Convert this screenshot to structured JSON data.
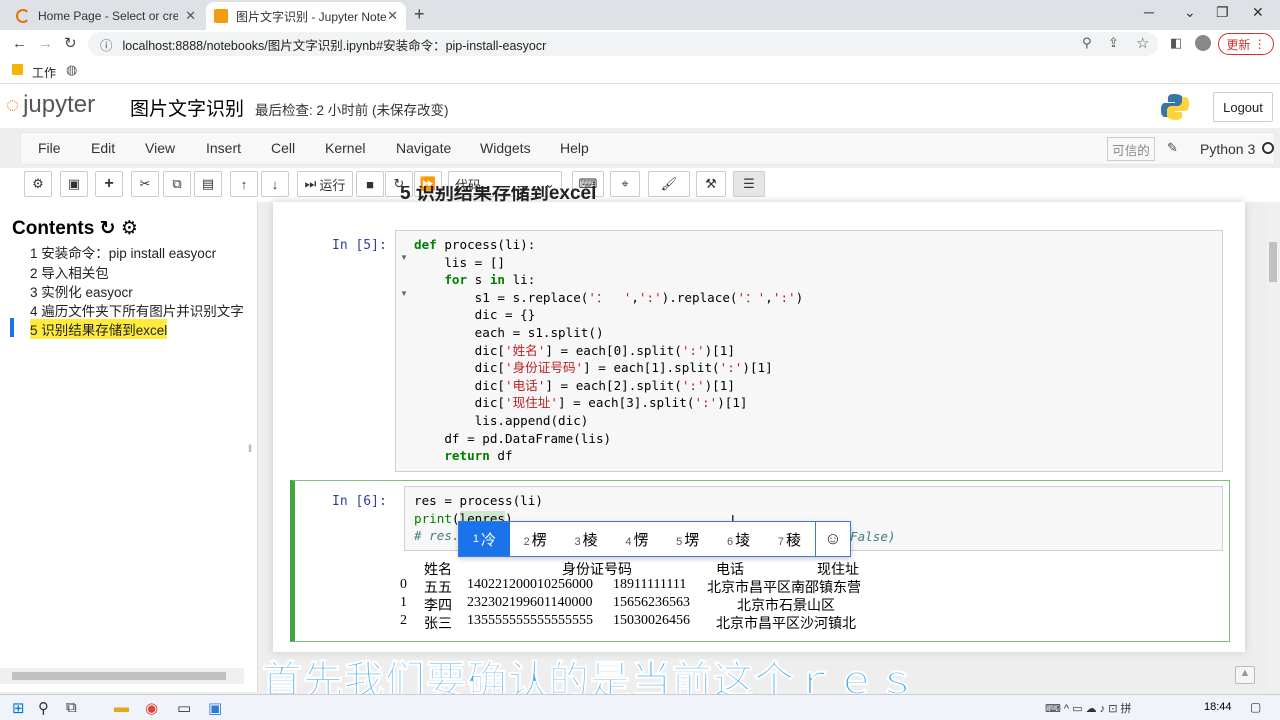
{
  "browser": {
    "tabs": [
      {
        "title": "Home Page - Select or create a",
        "active": false
      },
      {
        "title": "图片文字识别 - Jupyter Notebo",
        "active": true
      }
    ],
    "url": "localhost:8888/notebooks/图片文字识别.ipynb#安装命令：pip-install-easyocr",
    "bookmark": "工作",
    "update_label": "更新"
  },
  "jupyter": {
    "logo": "jupyter",
    "title": "图片文字识别",
    "checkpoint": "最后检查: 2 小时前   (未保存改变)",
    "logout": "Logout",
    "menu": [
      "File",
      "Edit",
      "View",
      "Insert",
      "Cell",
      "Kernel",
      "Navigate",
      "Widgets",
      "Help"
    ],
    "trusted": "可信的",
    "kernel": "Python 3",
    "run_label": "运行",
    "cell_type": "代码"
  },
  "toc": {
    "title": "Contents",
    "items": [
      "1  安装命令：pip install easyocr",
      "2  导入相关包",
      "3  实例化 easyocr",
      "4  遍历文件夹下所有图片并识别文字",
      "5  识别结果存储到excel"
    ]
  },
  "heading_partial": "5  识别结果存储到excel",
  "cells": {
    "c5_prompt": "In  [5]:",
    "c6_prompt": "In  [6]:",
    "c6_comment_tail": "False)"
  },
  "ime": {
    "candidates": [
      "冷",
      "楞",
      "棱",
      "愣",
      "塄",
      "堎",
      "稜"
    ]
  },
  "output": {
    "header": [
      "姓名",
      "身份证号码",
      "电话",
      "现住址"
    ],
    "rows": [
      [
        "0",
        "五五",
        "140221200010256000",
        "18911111111",
        "北京市昌平区南邵镇东营"
      ],
      [
        "1",
        "李四",
        "232302199601140000",
        "15656236563",
        "北京市石景山区"
      ],
      [
        "2",
        "张三",
        "135555555555555555",
        "15030026456",
        "北京市昌平区沙河镇北"
      ]
    ]
  },
  "subtitle": "首先我们要确认的是当前这个ｒｅｓ",
  "clock": "18:44",
  "colors": {
    "accent": "#1a73e8",
    "edit_cell": "#42a542",
    "subtitle": "#3fa9f5"
  }
}
